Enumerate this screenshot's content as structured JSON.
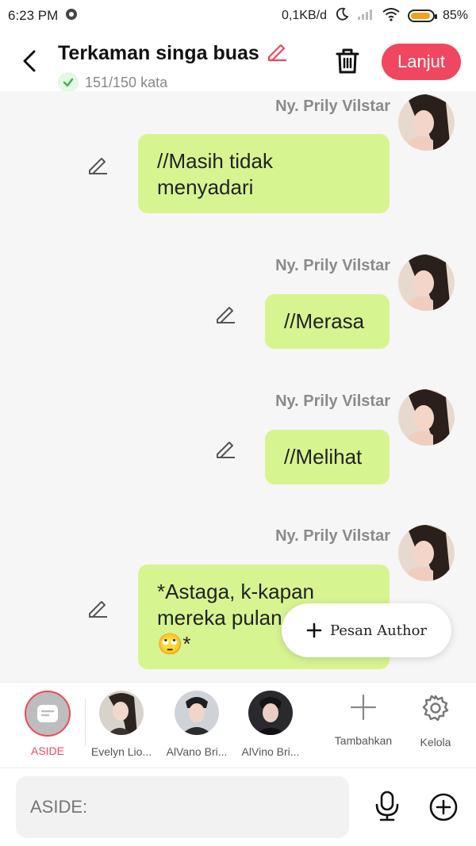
{
  "status": {
    "time": "6:23 PM",
    "network_speed": "0,1KB/d",
    "battery": "85%"
  },
  "header": {
    "title": "Terkaman singa buas",
    "word_count": "151/150 kata",
    "next_label": "Lanjut"
  },
  "messages": [
    {
      "sender": "Ny. Prily Vilstar",
      "lines": [
        "//Masih tidak",
        "menyadari"
      ]
    },
    {
      "sender": "Ny. Prily Vilstar",
      "lines": [
        "//Merasa"
      ]
    },
    {
      "sender": "Ny. Prily Vilstar",
      "lines": [
        "//Melihat"
      ]
    },
    {
      "sender": "Ny. Prily Vilstar",
      "lines": [
        "*Astaga, k-kapan",
        "mereka pulan",
        "🙄*"
      ]
    }
  ],
  "pesan_author": "Pesan Author",
  "characters": [
    {
      "label": "ASIDE"
    },
    {
      "label": "Evelyn Lio..."
    },
    {
      "label": "AlVano Bri..."
    },
    {
      "label": "AlVino Bri..."
    }
  ],
  "tools": {
    "add_label": "Tambahkan",
    "manage_label": "Kelola"
  },
  "input": {
    "placeholder": "ASIDE:"
  },
  "colors": {
    "accent": "#f0465f",
    "bubble": "#d6f591",
    "chat_bg": "#f6f6f6"
  }
}
